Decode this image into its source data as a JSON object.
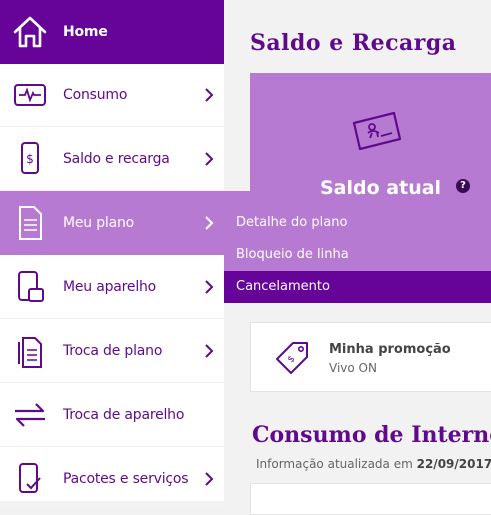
{
  "sidebar": {
    "items": [
      {
        "label": "Home",
        "icon": "home-icon"
      },
      {
        "label": "Consumo",
        "icon": "pulse-monitor-icon"
      },
      {
        "label": "Saldo e recarga",
        "icon": "phone-dollar-icon"
      },
      {
        "label": "Meu plano",
        "icon": "document-icon"
      },
      {
        "label": "Meu aparelho",
        "icon": "devices-icon"
      },
      {
        "label": "Troca de plano",
        "icon": "documents-icon"
      },
      {
        "label": "Troca de aparelho",
        "icon": "exchange-arrows-icon"
      },
      {
        "label": "Pacotes e serviços",
        "icon": "phone-check-icon"
      }
    ]
  },
  "submenu": {
    "items": [
      {
        "label": "Detalhe do plano"
      },
      {
        "label": "Bloqueio de linha"
      },
      {
        "label": "Cancelamento"
      }
    ]
  },
  "main": {
    "title": "Saldo e Recarga",
    "saldo_heading": "Saldo atual",
    "help": "?",
    "promo": {
      "title": "Minha promoção",
      "subtitle": "Vivo ON"
    },
    "consumo_title": "Consumo de Internet",
    "updated_prefix": "Informação atualizada em",
    "updated_date": "22/09/2017"
  },
  "colors": {
    "primary": "#66049a",
    "accent": "#b77ad3",
    "text": "#5f0a8a"
  }
}
